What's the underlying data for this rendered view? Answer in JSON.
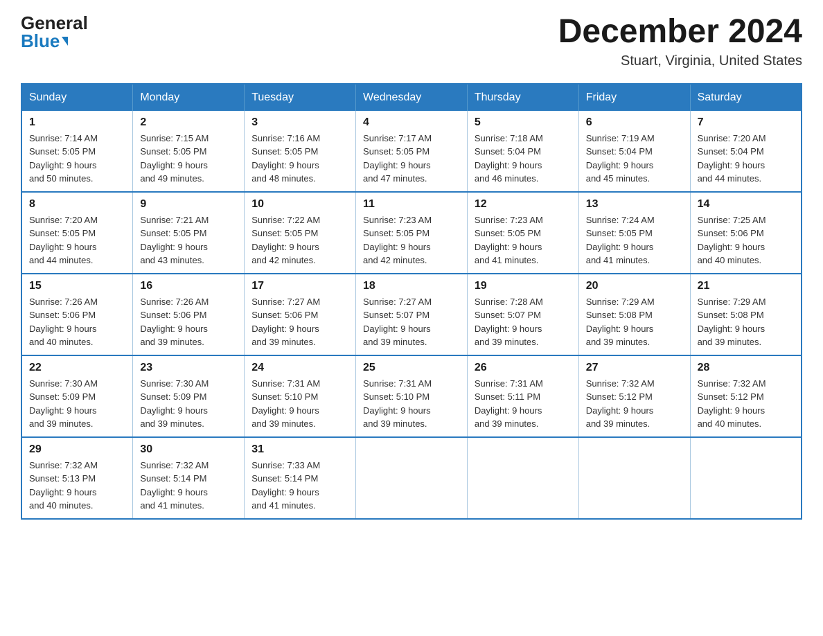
{
  "header": {
    "logo_line1": "General",
    "logo_line2": "Blue",
    "month_title": "December 2024",
    "location": "Stuart, Virginia, United States"
  },
  "days_of_week": [
    "Sunday",
    "Monday",
    "Tuesday",
    "Wednesday",
    "Thursday",
    "Friday",
    "Saturday"
  ],
  "weeks": [
    [
      {
        "day": "1",
        "sunrise": "7:14 AM",
        "sunset": "5:05 PM",
        "daylight": "9 hours and 50 minutes."
      },
      {
        "day": "2",
        "sunrise": "7:15 AM",
        "sunset": "5:05 PM",
        "daylight": "9 hours and 49 minutes."
      },
      {
        "day": "3",
        "sunrise": "7:16 AM",
        "sunset": "5:05 PM",
        "daylight": "9 hours and 48 minutes."
      },
      {
        "day": "4",
        "sunrise": "7:17 AM",
        "sunset": "5:05 PM",
        "daylight": "9 hours and 47 minutes."
      },
      {
        "day": "5",
        "sunrise": "7:18 AM",
        "sunset": "5:04 PM",
        "daylight": "9 hours and 46 minutes."
      },
      {
        "day": "6",
        "sunrise": "7:19 AM",
        "sunset": "5:04 PM",
        "daylight": "9 hours and 45 minutes."
      },
      {
        "day": "7",
        "sunrise": "7:20 AM",
        "sunset": "5:04 PM",
        "daylight": "9 hours and 44 minutes."
      }
    ],
    [
      {
        "day": "8",
        "sunrise": "7:20 AM",
        "sunset": "5:05 PM",
        "daylight": "9 hours and 44 minutes."
      },
      {
        "day": "9",
        "sunrise": "7:21 AM",
        "sunset": "5:05 PM",
        "daylight": "9 hours and 43 minutes."
      },
      {
        "day": "10",
        "sunrise": "7:22 AM",
        "sunset": "5:05 PM",
        "daylight": "9 hours and 42 minutes."
      },
      {
        "day": "11",
        "sunrise": "7:23 AM",
        "sunset": "5:05 PM",
        "daylight": "9 hours and 42 minutes."
      },
      {
        "day": "12",
        "sunrise": "7:23 AM",
        "sunset": "5:05 PM",
        "daylight": "9 hours and 41 minutes."
      },
      {
        "day": "13",
        "sunrise": "7:24 AM",
        "sunset": "5:05 PM",
        "daylight": "9 hours and 41 minutes."
      },
      {
        "day": "14",
        "sunrise": "7:25 AM",
        "sunset": "5:06 PM",
        "daylight": "9 hours and 40 minutes."
      }
    ],
    [
      {
        "day": "15",
        "sunrise": "7:26 AM",
        "sunset": "5:06 PM",
        "daylight": "9 hours and 40 minutes."
      },
      {
        "day": "16",
        "sunrise": "7:26 AM",
        "sunset": "5:06 PM",
        "daylight": "9 hours and 39 minutes."
      },
      {
        "day": "17",
        "sunrise": "7:27 AM",
        "sunset": "5:06 PM",
        "daylight": "9 hours and 39 minutes."
      },
      {
        "day": "18",
        "sunrise": "7:27 AM",
        "sunset": "5:07 PM",
        "daylight": "9 hours and 39 minutes."
      },
      {
        "day": "19",
        "sunrise": "7:28 AM",
        "sunset": "5:07 PM",
        "daylight": "9 hours and 39 minutes."
      },
      {
        "day": "20",
        "sunrise": "7:29 AM",
        "sunset": "5:08 PM",
        "daylight": "9 hours and 39 minutes."
      },
      {
        "day": "21",
        "sunrise": "7:29 AM",
        "sunset": "5:08 PM",
        "daylight": "9 hours and 39 minutes."
      }
    ],
    [
      {
        "day": "22",
        "sunrise": "7:30 AM",
        "sunset": "5:09 PM",
        "daylight": "9 hours and 39 minutes."
      },
      {
        "day": "23",
        "sunrise": "7:30 AM",
        "sunset": "5:09 PM",
        "daylight": "9 hours and 39 minutes."
      },
      {
        "day": "24",
        "sunrise": "7:31 AM",
        "sunset": "5:10 PM",
        "daylight": "9 hours and 39 minutes."
      },
      {
        "day": "25",
        "sunrise": "7:31 AM",
        "sunset": "5:10 PM",
        "daylight": "9 hours and 39 minutes."
      },
      {
        "day": "26",
        "sunrise": "7:31 AM",
        "sunset": "5:11 PM",
        "daylight": "9 hours and 39 minutes."
      },
      {
        "day": "27",
        "sunrise": "7:32 AM",
        "sunset": "5:12 PM",
        "daylight": "9 hours and 39 minutes."
      },
      {
        "day": "28",
        "sunrise": "7:32 AM",
        "sunset": "5:12 PM",
        "daylight": "9 hours and 40 minutes."
      }
    ],
    [
      {
        "day": "29",
        "sunrise": "7:32 AM",
        "sunset": "5:13 PM",
        "daylight": "9 hours and 40 minutes."
      },
      {
        "day": "30",
        "sunrise": "7:32 AM",
        "sunset": "5:14 PM",
        "daylight": "9 hours and 41 minutes."
      },
      {
        "day": "31",
        "sunrise": "7:33 AM",
        "sunset": "5:14 PM",
        "daylight": "9 hours and 41 minutes."
      },
      null,
      null,
      null,
      null
    ]
  ],
  "labels": {
    "sunrise": "Sunrise:",
    "sunset": "Sunset:",
    "daylight": "Daylight:"
  }
}
